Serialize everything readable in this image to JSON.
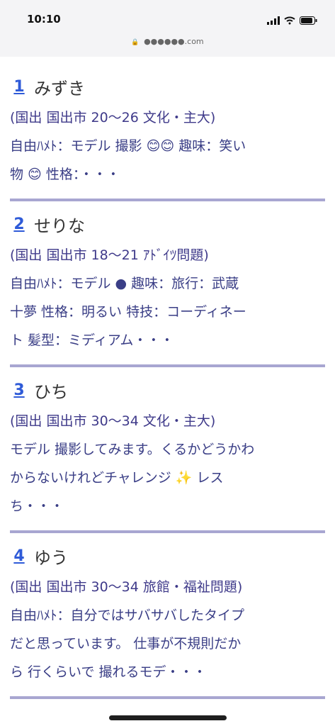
{
  "status": {
    "time": "10:10",
    "url": "●●●●●●.com"
  },
  "entries": [
    {
      "num": "1",
      "name": "みずき",
      "meta": "(国出 国出市 20〜26 文化・主大)",
      "desc": "自由ﾊﾒﾄ：モデル 撮影 😊😊 趣味：笑い",
      "tail": "物 😊 性格：・・・"
    },
    {
      "num": "2",
      "name": "せりな",
      "meta": "(国出 国出市 18〜21 ｱﾄﾞｲﾂ問題)",
      "desc": "自由ﾊﾒﾄ：モデル ● 趣味：旅行：武蔵",
      "tail": "十夢 性格：明るい 特技：コーディネー",
      "tail2": "ト 髪型：ミディアム・・・"
    },
    {
      "num": "3",
      "name": "ひち",
      "meta": "(国出 国出市 30〜34 文化・主大)",
      "desc": "モデル 撮影してみます。くるかどうかわ",
      "tail": "からないけれどチャレンジ ✨ レス",
      "tail2": "ち・・・"
    },
    {
      "num": "4",
      "name": "ゆう",
      "meta": "(国出 国出市 30〜34 旅館・福祉問題)",
      "desc": "自由ﾊﾒﾄ：自分ではサバサバしたタイプ",
      "tail": "だと思っています。 仕事が不規則だか",
      "tail2": "ら 行くらいで 撮れるモデ・・・"
    }
  ]
}
